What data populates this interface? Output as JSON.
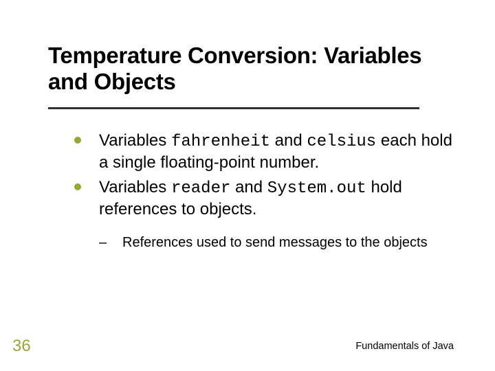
{
  "title": "Temperature Conversion: Variables and Objects",
  "bullets": [
    {
      "pre": "Variables ",
      "code1": "fahrenheit",
      "mid": " and ",
      "code2": "celsius",
      "post": " each hold a single floating-point number."
    },
    {
      "pre": "Variables ",
      "code1": "reader",
      "mid": " and ",
      "code2": "System.out",
      "post": " hold references to objects."
    }
  ],
  "subbullet": "References used to send messages to the objects",
  "page_number": "36",
  "footer": "Fundamentals of Java"
}
